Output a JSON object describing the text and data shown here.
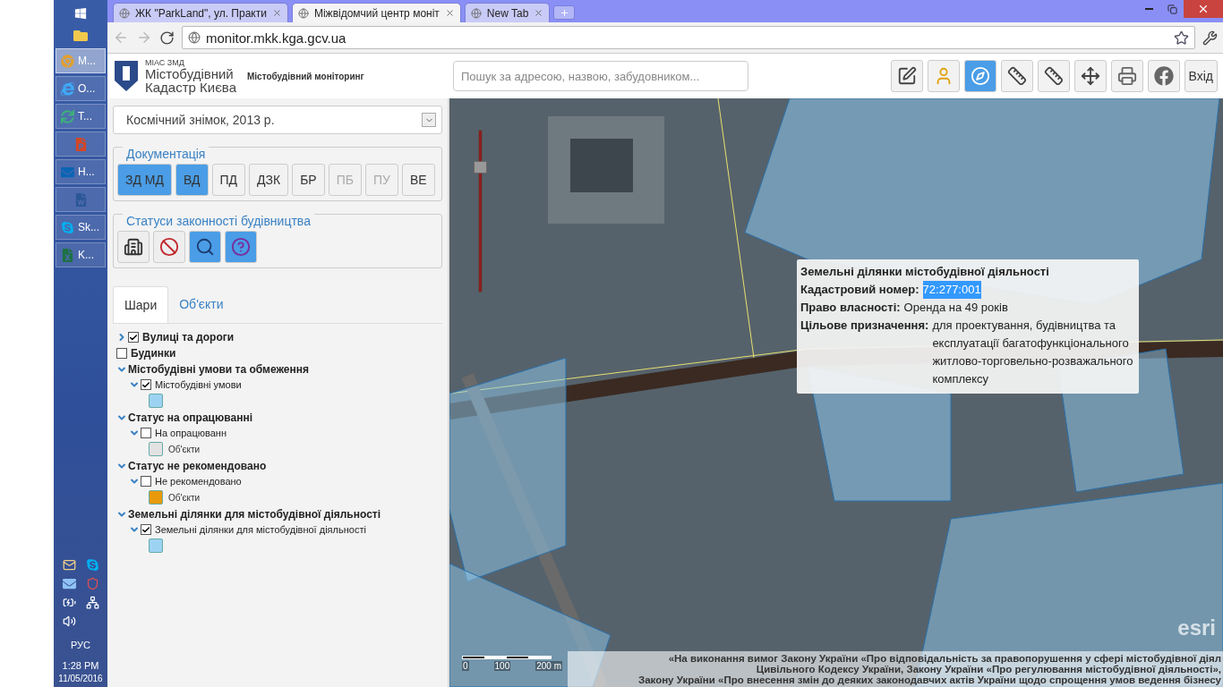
{
  "browser": {
    "tabs": [
      {
        "title": "ЖК \"ParkLand\", ул. Практи",
        "selected": false
      },
      {
        "title": "Міжвідомчий центр моніт",
        "selected": true
      },
      {
        "title": "New Tab",
        "selected": false
      }
    ],
    "address": "monitor.mkk.kga.gcv.ua"
  },
  "taskbar": {
    "apps": [
      {
        "kind": "chrome",
        "label": "M...",
        "selected": true
      },
      {
        "kind": "ie",
        "label": "O...",
        "selected": false
      },
      {
        "kind": "sync",
        "label": "T...",
        "selected": false
      },
      {
        "kind": "slides",
        "selected": false
      },
      {
        "kind": "mail",
        "label": "H...",
        "selected": false
      },
      {
        "kind": "doc",
        "selected": false
      },
      {
        "kind": "skype",
        "label": "Sk...",
        "selected": false
      },
      {
        "kind": "sheet",
        "label": "K...",
        "selected": false
      }
    ],
    "language": "РУС",
    "time": "1:28 PM",
    "date": "11/05/2016"
  },
  "header": {
    "logo_small": "МІАС ЗМД",
    "logo_line1": "Містобудівний",
    "logo_line2": "Кадастр Києва",
    "subtitle": "Містобудівний моніторинг",
    "search_placeholder": "Пошук за адресою, назвою, забудовником...",
    "tools": [
      {
        "kind": "edit",
        "selected": false
      },
      {
        "kind": "person",
        "selected": false
      },
      {
        "kind": "compass",
        "selected": true
      },
      {
        "kind": "ruler-line",
        "selected": false
      },
      {
        "kind": "ruler-area",
        "selected": false
      },
      {
        "kind": "pan",
        "selected": false
      },
      {
        "kind": "print",
        "selected": false
      },
      {
        "kind": "facebook",
        "selected": false
      }
    ],
    "login": "Вхід"
  },
  "sidebar": {
    "basemap": "Космічний знімок, 2013 р.",
    "documentation": {
      "legend": "Документація",
      "buttons": [
        {
          "label": "ЗД МД",
          "selected": true,
          "disabled": false
        },
        {
          "label": "ВД",
          "selected": true,
          "disabled": false
        },
        {
          "label": "ПД",
          "selected": false,
          "disabled": false
        },
        {
          "label": "ДЗК",
          "selected": false,
          "disabled": false
        },
        {
          "label": "БР",
          "selected": false,
          "disabled": false
        },
        {
          "label": "ПБ",
          "selected": false,
          "disabled": true
        },
        {
          "label": "ПУ",
          "selected": false,
          "disabled": true
        },
        {
          "label": "ВЕ",
          "selected": false,
          "disabled": false
        }
      ]
    },
    "statuses": {
      "legend": "Статуси законності будівництва",
      "buttons": [
        {
          "kind": "crane",
          "selected": false
        },
        {
          "kind": "no-build",
          "selected": false
        },
        {
          "kind": "search",
          "selected": true
        },
        {
          "kind": "question",
          "selected": true
        }
      ]
    },
    "tabs": [
      {
        "label": "Шари",
        "selected": true
      },
      {
        "label": "Об'єкти",
        "selected": false
      }
    ],
    "layers": [
      {
        "kind": "layer",
        "label": "Вулиці та дороги",
        "checked": true,
        "expanded": false
      },
      {
        "kind": "layer",
        "label": "Будинки",
        "checked": false
      },
      {
        "kind": "group",
        "label": "Містобудівні умови та обмеження",
        "expanded": true,
        "children": [
          {
            "kind": "layer",
            "label": "Містобудівні умови",
            "checked": true,
            "expanded": true,
            "legend": [
              {
                "color": "#9dd3f2"
              }
            ]
          }
        ]
      },
      {
        "kind": "group",
        "label": "Статус на опрацюванні",
        "expanded": true,
        "children": [
          {
            "kind": "layer",
            "label": "На опрацюванн",
            "checked": false,
            "expanded": true,
            "legend": [
              {
                "color": "#e2e2e2",
                "label": "Об'єкти"
              }
            ]
          }
        ]
      },
      {
        "kind": "group",
        "label": "Статус не рекомендовано",
        "expanded": true,
        "children": [
          {
            "kind": "layer",
            "label": "Не рекомендовано",
            "checked": false,
            "expanded": true,
            "legend": [
              {
                "color": "#e89a0c",
                "label": "Об'єкти"
              }
            ]
          }
        ]
      },
      {
        "kind": "group",
        "label": "Земельні ділянки для містобудівної діяльності",
        "expanded": true,
        "children": [
          {
            "kind": "layer",
            "label": "Земельні ділянки для містобудівної діяльності",
            "checked": true,
            "expanded": true,
            "legend": [
              {
                "color": "#9dd3f2"
              }
            ]
          }
        ]
      }
    ]
  },
  "map": {
    "zoom_slider": {
      "level": 0.77
    },
    "popup": {
      "title": "Земельні ділянки містобудівної діяльності",
      "rows": [
        {
          "label": "Кадастровий номер:",
          "value": "72:277:001",
          "highlighted": true
        },
        {
          "label": "Право власності:",
          "value": "Оренда на 49 років",
          "highlighted": false
        },
        {
          "label": "Цільове призначення:",
          "value": "для проектування, будівництва та експлуатації багатофункціонального житлово-торговельно-розважального комплексу",
          "highlighted": false
        }
      ]
    },
    "scale": [
      "0",
      "100",
      "200 m"
    ],
    "attribution": [
      "«На виконання вимог Закону України «Про відповідальність за правопорушення у сфері містобудівної діял",
      "Цивільного Кодексу України, Закону України «Про регулювання містобудівної діяльності»,",
      "Закону України «Про внесення змін до деяких законодавчих актів України щодо спрощення умов ведення бізнесу"
    ],
    "logo": "esri"
  }
}
